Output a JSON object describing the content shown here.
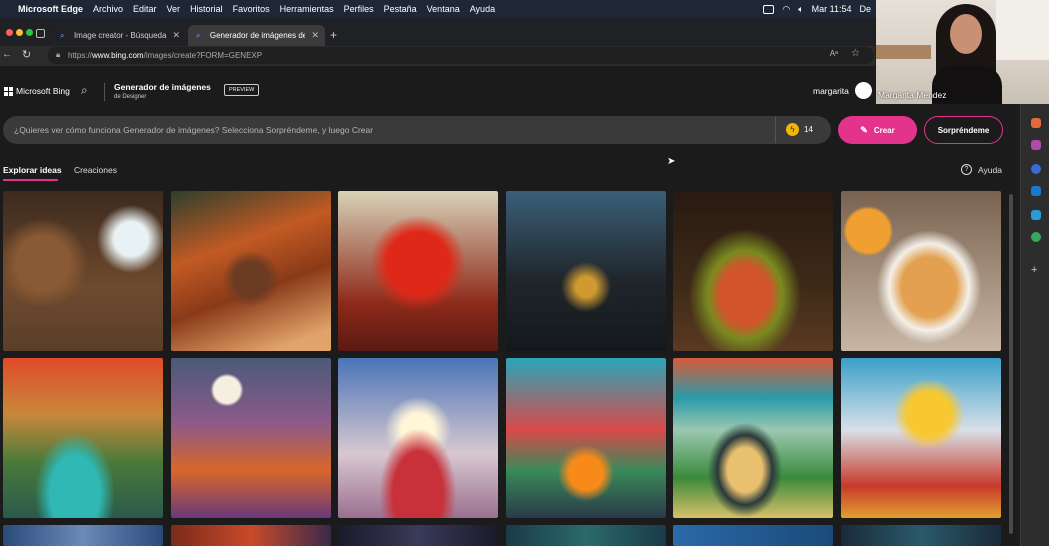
{
  "menubar": {
    "app": "Microsoft Edge",
    "items": [
      "Archivo",
      "Editar",
      "Ver",
      "Historial",
      "Favoritos",
      "Herramientas",
      "Perfiles",
      "Pestaña",
      "Ventana",
      "Ayuda"
    ],
    "clock": "Mar 11:54",
    "clock_extra": "De"
  },
  "tabs": [
    {
      "title": "Image creator - Búsqueda",
      "active": false
    },
    {
      "title": "Generador de imágenes de Mi",
      "active": true
    }
  ],
  "address": {
    "url_prefix": "https://",
    "url_domain": "www.bing.com",
    "url_path": "/images/create?FORM=GENEXP"
  },
  "bing": {
    "logo": "Microsoft Bing",
    "product_title": "Generador de imágenes",
    "product_sub": "de Designer",
    "preview_badge": "PREVIEW",
    "user": "margarita"
  },
  "prompt": {
    "placeholder": "¿Quieres ver cómo funciona Generador de imágenes? Selecciona Sorpréndeme, y luego Crear",
    "boosts": "14",
    "create_label": "Crear",
    "surprise_label": "Sorpréndeme"
  },
  "tabs_content": {
    "explore": "Explorar ideas",
    "creations": "Creaciones",
    "help": "Ayuda"
  },
  "webcam": {
    "name": "Margarita Mendez"
  },
  "colors": {
    "accent_pink": "#e3338d",
    "brand_dark": "#1b1b1b"
  },
  "gallery": [
    {
      "subject": "bears in a cozy cave"
    },
    {
      "subject": "autumn cabin in forest"
    },
    {
      "subject": "red maple leaf"
    },
    {
      "subject": "gothic castle at night"
    },
    {
      "subject": "cornucopia of fruit"
    },
    {
      "subject": "pancakes with syrup and juice"
    },
    {
      "subject": "waterfall with unicorn and rainbow"
    },
    {
      "subject": "fantasy autumn landscape with moons"
    },
    {
      "subject": "festive crowd under crescent moon"
    },
    {
      "subject": "colorful felt village with campfire"
    },
    {
      "subject": "woman overlooking colorful landscape"
    },
    {
      "subject": "paper-craft city skyline"
    }
  ]
}
